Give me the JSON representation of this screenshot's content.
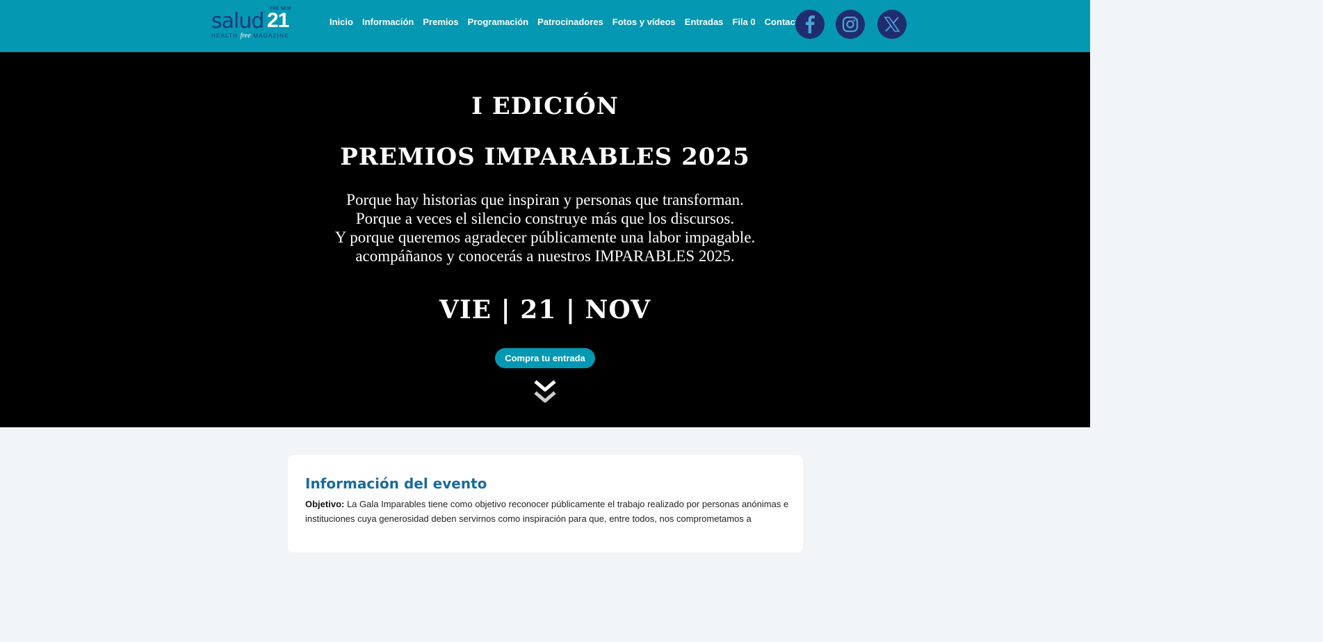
{
  "logo": {
    "word": "salud",
    "number": "21",
    "superscript": "THE NEW",
    "tag_left": "HEALTH",
    "tag_mid": "free",
    "tag_right": "MAGAZINE"
  },
  "nav": {
    "items": [
      {
        "label": "Inicio"
      },
      {
        "label": "Información"
      },
      {
        "label": "Premios"
      },
      {
        "label": "Programación"
      },
      {
        "label": "Patrocinadores"
      },
      {
        "label": "Fotos y vídeos"
      },
      {
        "label": "Entradas"
      },
      {
        "label": "Fila 0"
      },
      {
        "label": "Contacto"
      }
    ]
  },
  "social": [
    {
      "icon": "facebook-icon"
    },
    {
      "icon": "instagram-icon"
    },
    {
      "icon": "x-icon"
    }
  ],
  "hero": {
    "edition": "I EDICIÓN",
    "title": "PREMIOS IMPARABLES 2025",
    "lines": [
      "Porque hay historias que inspiran y personas que transforman.",
      "Porque a veces el silencio construye más que los discursos.",
      "Y porque queremos agradecer públicamente una labor impagable.",
      "acompáñanos y conocerás a nuestros IMPARABLES 2025."
    ],
    "date": "VIE | 21 | NOV",
    "cta_label": "Compra tu entrada",
    "scroll_icon": "double-chevron-down-icon"
  },
  "info": {
    "title": "Información del evento",
    "objective_label": "Objetivo:",
    "objective_text": " La Gala Imparables tiene como objetivo reconocer públicamente el trabajo realizado por personas anónimas e instituciones cuya generosidad deben servirnos como inspiración para que, entre todos, nos comprometamos a"
  },
  "colors": {
    "header_bg": "#0498b2",
    "social_bg": "#1f2d6e",
    "hero_bg": "#000000",
    "accent_title": "#1a6a9a"
  }
}
